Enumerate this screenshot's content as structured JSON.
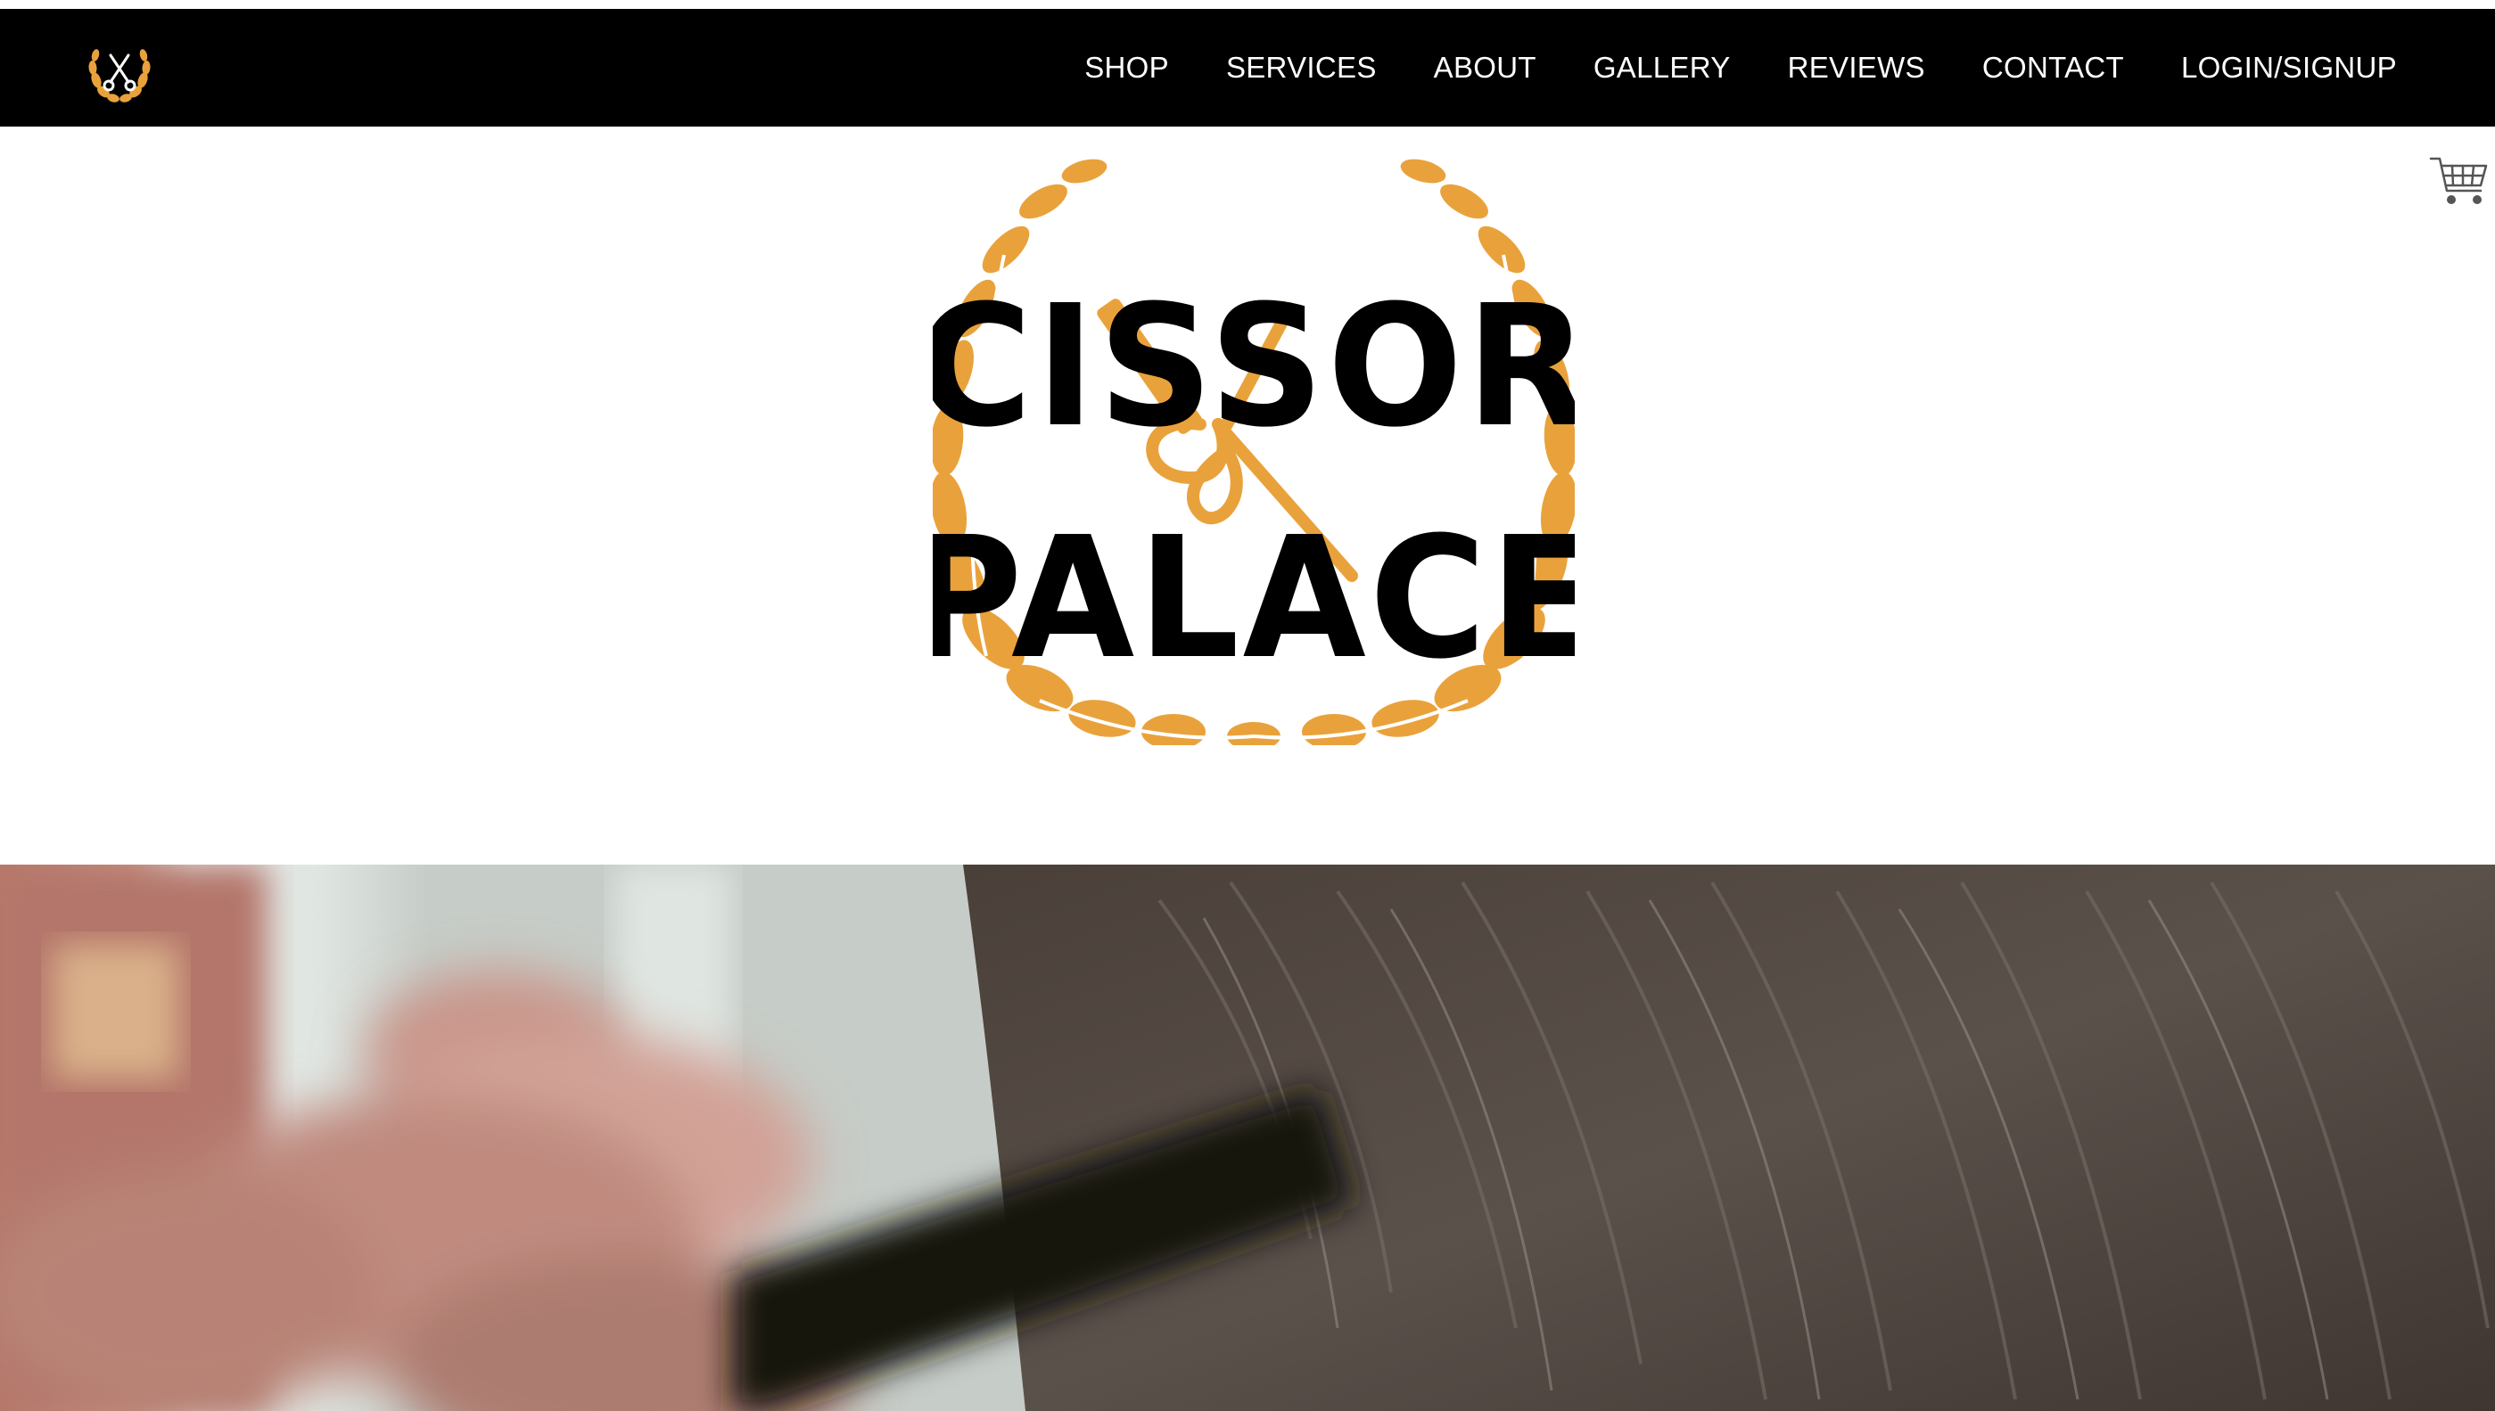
{
  "nav": {
    "logo_icon": "scissors-laurel-icon",
    "items": [
      {
        "label": "SHOP"
      },
      {
        "label": "SERVICES"
      },
      {
        "label": "ABOUT"
      },
      {
        "label": "GALLERY"
      },
      {
        "label": "REVIEWS"
      },
      {
        "label": "CONTACT"
      },
      {
        "label": "LOGIN/SIGNUP"
      }
    ]
  },
  "cart": {
    "icon": "shopping-cart-icon"
  },
  "brand": {
    "logo_line1": "SCISSORS",
    "logo_line2": "PALACE",
    "accent_color": "#E9A23B",
    "text_color": "#000000"
  },
  "hero": {
    "image": "barber-combing-hair-video"
  }
}
